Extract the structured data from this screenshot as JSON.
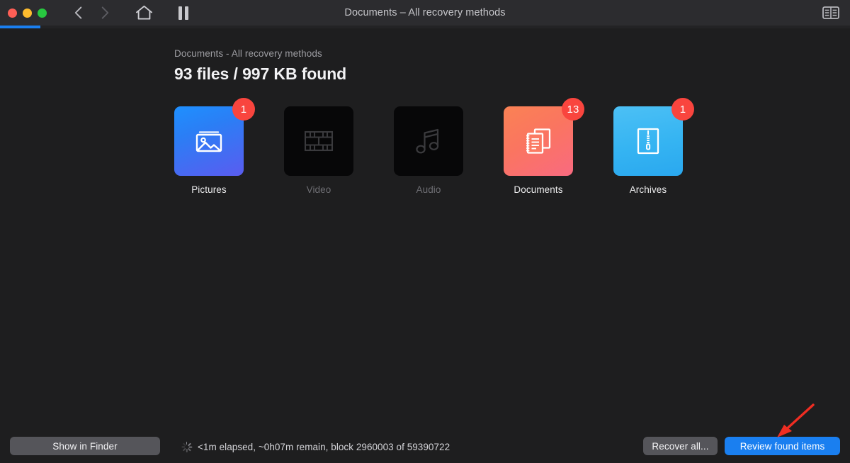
{
  "window": {
    "title": "Documents – All recovery methods",
    "traffic_lights": [
      "close",
      "minimize",
      "maximize"
    ]
  },
  "toolbar": {
    "back_icon": "chevron-left-icon",
    "forward_icon": "chevron-right-icon",
    "home_icon": "home-icon",
    "pause_icon": "pause-icon",
    "panel_icon": "sidebar-toggle-icon"
  },
  "progress": {
    "percent": 4.75,
    "color": "#1a7ff0"
  },
  "header": {
    "subtitle": "Documents - All recovery methods",
    "title": "93 files / 997 KB found"
  },
  "categories": [
    {
      "label": "Pictures",
      "badge": "1",
      "icon": "picture-icon",
      "enabled": true
    },
    {
      "label": "Video",
      "badge": null,
      "icon": "film-icon",
      "enabled": false
    },
    {
      "label": "Audio",
      "badge": null,
      "icon": "music-note-icon",
      "enabled": false
    },
    {
      "label": "Documents",
      "badge": "13",
      "icon": "documents-icon",
      "enabled": true
    },
    {
      "label": "Archives",
      "badge": "1",
      "icon": "archive-zip-icon",
      "enabled": true
    }
  ],
  "footer": {
    "show_in_finder_label": "Show in Finder",
    "status_text": "<1m elapsed, ~0h07m remain, block 2960003 of 59390722",
    "spinner_icon": "loading-spinner-icon",
    "recover_all_label": "Recover all...",
    "review_label": "Review found items"
  },
  "annotation": {
    "arrow_icon": "red-arrow-annotation",
    "color": "#ef2d22"
  }
}
